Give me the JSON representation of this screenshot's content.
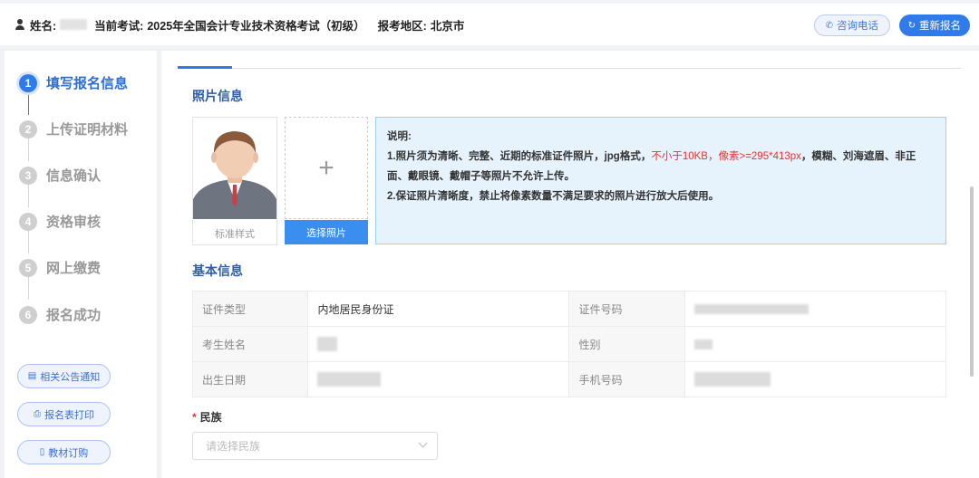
{
  "header": {
    "name_label": "姓名:",
    "exam_label": "当前考试:",
    "exam_value": "2025年全国会计专业技术资格考试（初级）",
    "region_label": "报考地区:",
    "region_value": "北京市",
    "consult_label": "咨询电话",
    "reapply_label": "重新报名"
  },
  "sidebar": {
    "steps": [
      {
        "num": "1",
        "label": "填写报名信息"
      },
      {
        "num": "2",
        "label": "上传证明材料"
      },
      {
        "num": "3",
        "label": "信息确认"
      },
      {
        "num": "4",
        "label": "资格审核"
      },
      {
        "num": "5",
        "label": "网上缴费"
      },
      {
        "num": "6",
        "label": "报名成功"
      }
    ],
    "buttons": {
      "notice": "相关公告通知",
      "print": "报名表打印",
      "books": "教材订购"
    }
  },
  "photo": {
    "section_title": "照片信息",
    "sample_caption": "标准样式",
    "choose_label": "选择照片",
    "note_title": "说明:",
    "note_line1_a": "1.照片须为清晰、完整、近期的标准证件照片，jpg格式，",
    "note_line1_red": "不小于10KB，像素>=295*413px",
    "note_line1_b": "，模糊、刘海遮眉、非正面、戴眼镜、戴帽子等照片不允许上传。",
    "note_line2": "2.保证照片清晰度，禁止将像素数量不满足要求的照片进行放大后使用。"
  },
  "basic": {
    "section_title": "基本信息",
    "id_type_label": "证件类型",
    "id_type_value": "内地居民身份证",
    "id_no_label": "证件号码",
    "name_label": "考生姓名",
    "gender_label": "性别",
    "birth_label": "出生日期",
    "phone_label": "手机号码"
  },
  "nation": {
    "label": "民族",
    "required_mark": "*",
    "placeholder": "请选择民族"
  },
  "colors": {
    "primary": "#2f7be9",
    "title_blue": "#2f5fa8",
    "note_bg": "#e6f3fd",
    "red": "#e53333"
  }
}
